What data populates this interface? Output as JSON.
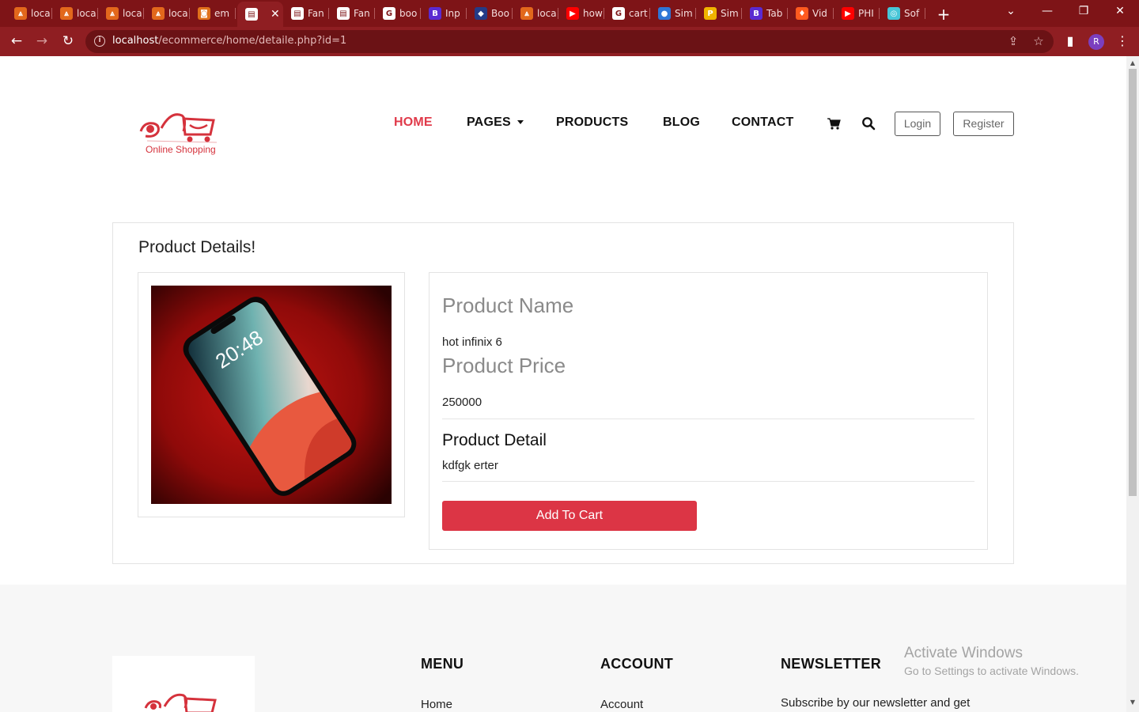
{
  "browser": {
    "tabs": [
      {
        "label": "loca",
        "icon": "xampp-icon",
        "color": "#e2681c"
      },
      {
        "label": "loca",
        "icon": "xampp-icon",
        "color": "#e2681c"
      },
      {
        "label": "loca",
        "icon": "xampp-icon",
        "color": "#e2681c"
      },
      {
        "label": "loca",
        "icon": "xampp-icon",
        "color": "#e2681c"
      },
      {
        "label": "em",
        "icon": "app-icon",
        "color": "#e0711b"
      },
      {
        "label": "",
        "icon": "site-icon",
        "color": "#ffffff",
        "active": true
      },
      {
        "label": "Fan",
        "icon": "site-icon",
        "color": "#ffffff"
      },
      {
        "label": "Fan",
        "icon": "site-icon",
        "color": "#ffffff"
      },
      {
        "label": "boo",
        "icon": "google-icon",
        "color": "#ffffff"
      },
      {
        "label": "Inp",
        "icon": "bootstrap-icon",
        "color": "#5a2bd1"
      },
      {
        "label": "Boo",
        "icon": "shield-icon",
        "color": "#243b87"
      },
      {
        "label": "loca",
        "icon": "xampp-icon",
        "color": "#e2681c"
      },
      {
        "label": "how",
        "icon": "youtube-icon",
        "color": "#ff0000"
      },
      {
        "label": "cart",
        "icon": "google-icon",
        "color": "#ffffff"
      },
      {
        "label": "Sim",
        "icon": "drupal-icon",
        "color": "#2f76d6"
      },
      {
        "label": "Sim",
        "icon": "p-icon",
        "color": "#f0b400"
      },
      {
        "label": "Tab",
        "icon": "bootstrap-icon",
        "color": "#5a2bd1"
      },
      {
        "label": "Vid",
        "icon": "flame-icon",
        "color": "#ff5a1f"
      },
      {
        "label": "PHI",
        "icon": "youtube-icon",
        "color": "#ff0000"
      },
      {
        "label": "Sof",
        "icon": "stack-icon",
        "color": "#48c6d8"
      }
    ],
    "url_host": "localhost",
    "url_path": "/ecommerce/home/detaile.php?id=1",
    "profile_initial": "R"
  },
  "header": {
    "logo_text": "Online Shopping",
    "nav": {
      "home": "HOME",
      "pages": "PAGES",
      "products": "PRODUCTS",
      "blog": "BLOG",
      "contact": "CONTACT"
    },
    "login": "Login",
    "register": "Register"
  },
  "product": {
    "section_title": "Product Details!",
    "name_label": "Product Name",
    "name": "hot infinix 6",
    "price_label": "Product Price",
    "price": "250000",
    "detail_label": "Product Detail",
    "detail": "kdfgk erter",
    "add_to_cart": "Add To Cart",
    "phone_time": "20:48"
  },
  "footer": {
    "menu_title": "MENU",
    "account_title": "ACCOUNT",
    "newsletter_title": "NEWSLETTER",
    "menu_first": "Home",
    "account_first": "Account",
    "newsletter_text": "Subscribe by our newsletter and get"
  },
  "watermark": {
    "line1": "Activate Windows",
    "line2": "Go to Settings to activate Windows."
  },
  "colors": {
    "chrome": "#7e1417",
    "accent": "#dc3545",
    "nav_active": "#e03a4a"
  }
}
